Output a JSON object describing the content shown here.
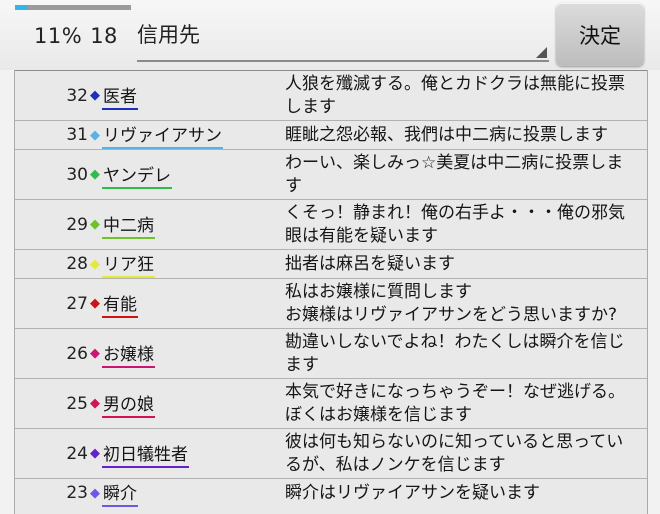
{
  "header": {
    "progress": 0.11,
    "progress_label": "11%",
    "count": "18",
    "selected_value": "信用先",
    "submit_label": "決定"
  },
  "rows": [
    {
      "num": "32",
      "color": "#1c2fb8",
      "name": "医者",
      "msg": "人狼を殲滅する。俺とカドクラは無能に投票します"
    },
    {
      "num": "31",
      "color": "#57b3e6",
      "name": "リヴァイアサン",
      "msg": "睚眦之怨必報、我們は中二病に投票します"
    },
    {
      "num": "30",
      "color": "#33bb4a",
      "name": "ヤンデレ",
      "msg": "わーい、楽しみっ☆美夏は中二病に投票します"
    },
    {
      "num": "29",
      "color": "#6fc22a",
      "name": "中二病",
      "msg": "くそっ！静まれ！俺の右手よ・・・俺の邪気眼は有能を疑います"
    },
    {
      "num": "28",
      "color": "#e4ea3c",
      "name": "リア狂",
      "msg": "拙者は麻呂を疑います"
    },
    {
      "num": "27",
      "color": "#cc1414",
      "name": "有能",
      "msg": "私はお嬢様に質問します\nお嬢様はリヴァイアサンをどう思いますか?"
    },
    {
      "num": "26",
      "color": "#cc1573",
      "name": "お嬢様",
      "msg": "勘違いしないでよね！わたくしは瞬介を信じます"
    },
    {
      "num": "25",
      "color": "#d21456",
      "name": "男の娘",
      "msg": "本気で好きになっちゃうぞー！なぜ逃げる。ぼくはお嬢様を信じます"
    },
    {
      "num": "24",
      "color": "#6422c8",
      "name": "初日犠牲者",
      "msg": "彼は何も知らないのに知っていると思っているが、私はノンケを信じます"
    },
    {
      "num": "23",
      "color": "#6a5ae6",
      "name": "瞬介",
      "msg": "瞬介はリヴァイアサンを疑います"
    }
  ]
}
